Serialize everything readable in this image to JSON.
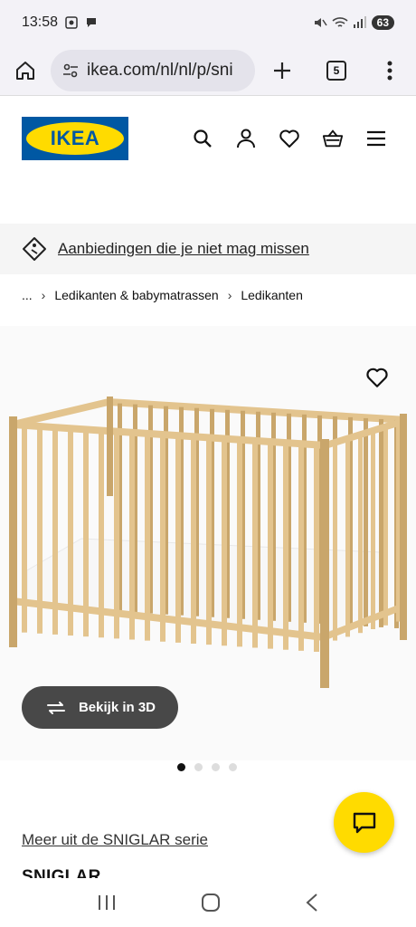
{
  "status_bar": {
    "time": "13:58",
    "battery": "63"
  },
  "browser": {
    "url": "ikea.com/nl/nl/p/sni",
    "tab_count": "5"
  },
  "header": {
    "logo_text": "IKEA",
    "icons": [
      "search-icon",
      "account-icon",
      "heart-icon",
      "basket-icon",
      "menu-icon"
    ]
  },
  "promo": {
    "text": "Aanbiedingen die je niet mag missen"
  },
  "breadcrumb": {
    "ellipsis": "...",
    "items": [
      "Ledikanten & babymatrassen",
      "Ledikanten"
    ]
  },
  "product": {
    "view_3d_label": "Bekijk in 3D",
    "series_link": "Meer uit de SNIGLAR serie",
    "name": "SNIGLAR",
    "gallery_count": 4,
    "gallery_active": 1
  },
  "colors": {
    "ikea_blue": "#0058a3",
    "ikea_yellow": "#ffdb00",
    "button_dark": "#484848"
  }
}
